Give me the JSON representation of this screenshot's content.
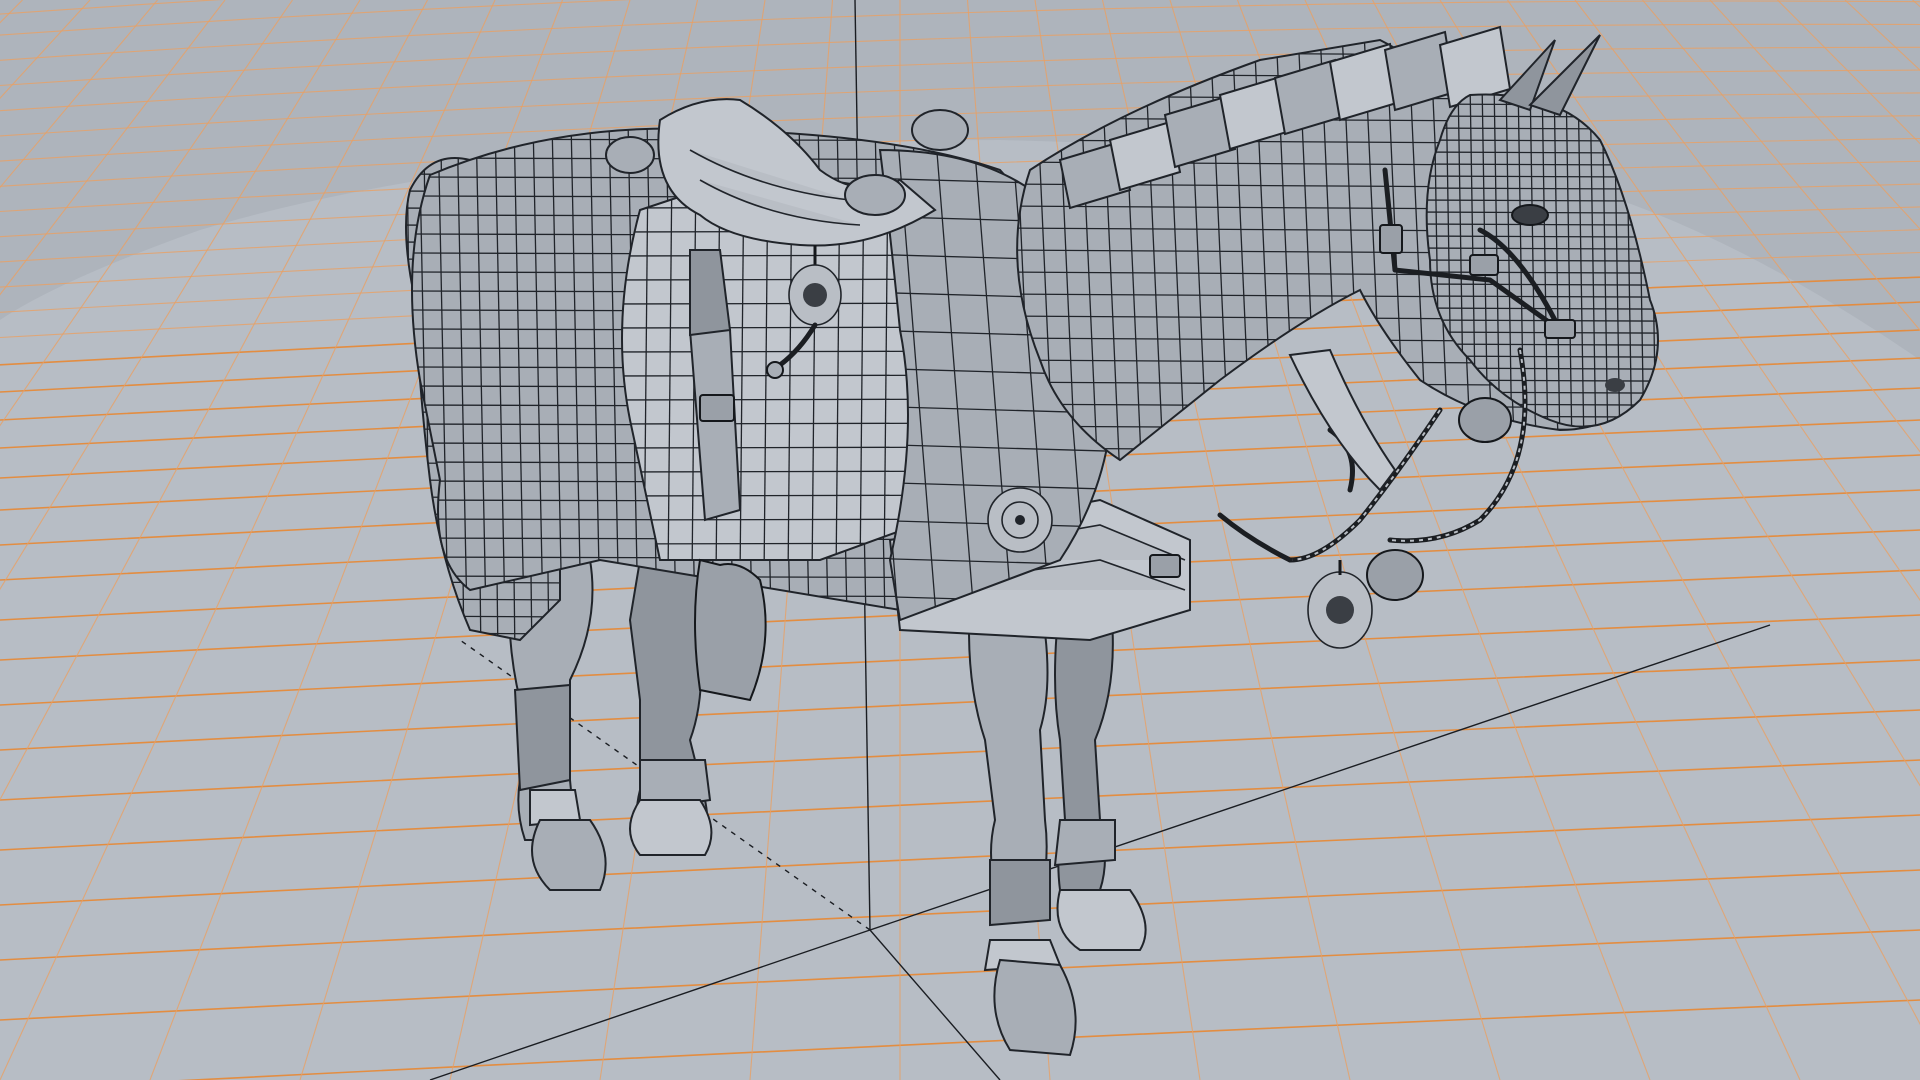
{
  "viewport": {
    "kind": "3d-modeling-viewport",
    "shading": "wireframe-over-solid",
    "background_color": "#b6bcc4",
    "grid_color": "#e58a3a",
    "wire_color": "#20242a",
    "mesh_color": "#a8aeb6"
  },
  "scene": {
    "subject": "horse",
    "parts": [
      "body",
      "saddle",
      "saddle-blanket",
      "chest-armor",
      "neck-armor",
      "bridle",
      "reins-chain",
      "stirrup",
      "leg-wraps",
      "medallions",
      "tail"
    ]
  }
}
